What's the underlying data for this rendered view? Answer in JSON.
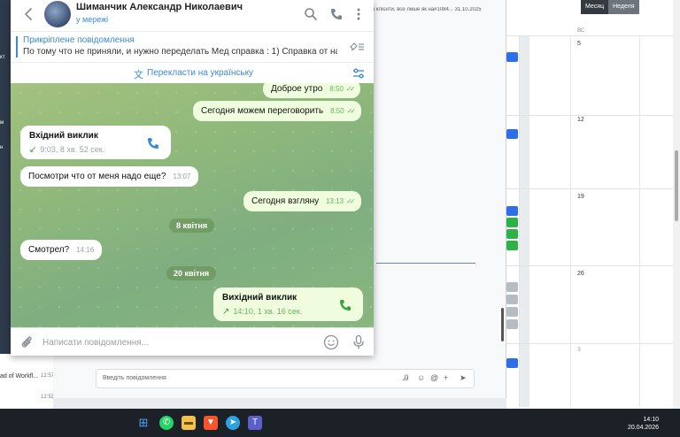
{
  "background": {
    "left_nav_marks": [
      "кт",
      "м",
      "н"
    ],
    "chat_list": [
      {
        "text": "ad of Workfl...",
        "time": "12:57"
      },
      {
        "text": "",
        "time": "12:53"
      }
    ],
    "top_snippet": "в клієнти, все лише як на#1084... 31.10.2025",
    "compose_placeholder": "Введіть повідомлення"
  },
  "calendar": {
    "view_buttons": [
      "Месяц",
      "Неделя"
    ],
    "dow": "ВС",
    "days": [
      "5",
      "12",
      "19",
      "26",
      "3"
    ],
    "colors": {
      "blue": "#2f6ee9",
      "green": "#2db24a",
      "gray": "#b7bcc2"
    }
  },
  "telegram": {
    "contact_name": "Шиманчик Александр Николаевич",
    "contact_status": "у мережі",
    "pinned": {
      "title": "Прикріплене повідомлення",
      "text": "По тому что не приняли, и нужно переделать Мед справка : 1) Справка от нар..."
    },
    "translate_label": "Перекласти на українську",
    "messages": {
      "m1": {
        "text": "Доброе утро",
        "time": "8:50"
      },
      "m2": {
        "text": "Сегодня можем переговорить",
        "time": "8:50"
      },
      "call_in": {
        "title": "Вхідний виклик",
        "detail": "9:03, 8 хв. 52 сек."
      },
      "m3": {
        "text": "Посмотри что от меня надо еще?",
        "time": "13:07"
      },
      "m4": {
        "text": "Сегодня взгляну",
        "time": "13:13"
      },
      "date1": "8 квітня",
      "m5": {
        "text": "Смотрел?",
        "time": "14:16"
      },
      "date2": "20 квітня",
      "call_out": {
        "title": "Вихідний виклик",
        "detail": "14:10, 1 хв. 16 сек."
      }
    },
    "composer_placeholder": "Написати повідомлення...",
    "colors": {
      "accent": "#3a8ad6",
      "out_bubble": "#effdde",
      "in_bubble": "#ffffff",
      "tick": "#64b75c"
    }
  },
  "taskbar": {
    "time": "14:10",
    "date": "20.04.2026",
    "icons": [
      "windows-icon",
      "whatsapp-icon",
      "folder-icon",
      "brave-icon",
      "telegram-icon",
      "teams-icon"
    ]
  }
}
